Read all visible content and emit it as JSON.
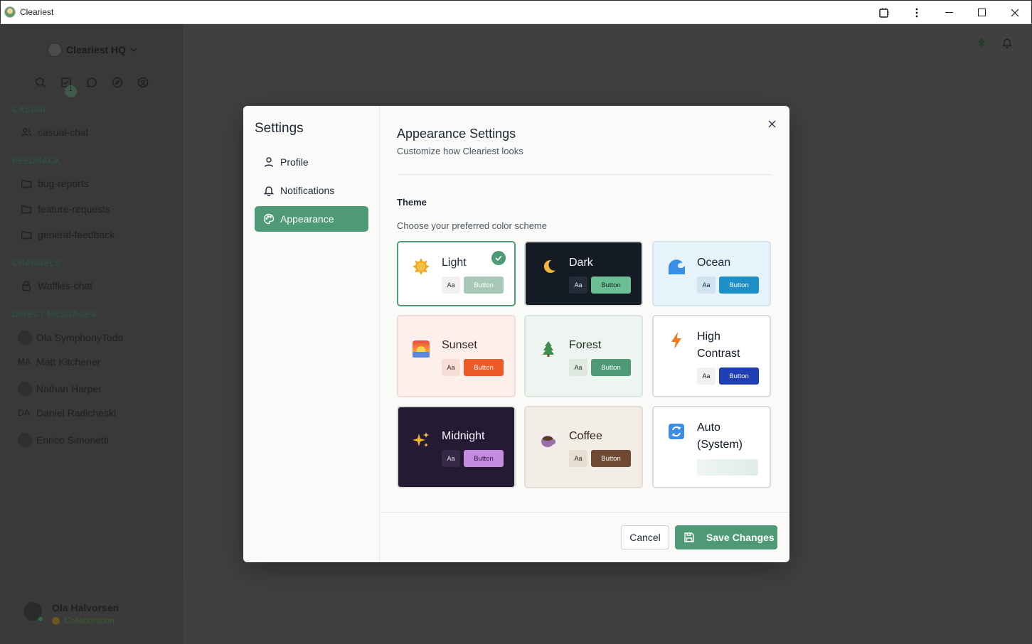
{
  "window": {
    "title": "Cleariest"
  },
  "workspace": {
    "name": "Cleariest HQ"
  },
  "sidebar": {
    "sections": [
      {
        "label": "CASUAL",
        "items": [
          "casual-chat"
        ]
      },
      {
        "label": "FEEDBACK",
        "items": [
          "bug-reports",
          "feature-requests",
          "general-feedback"
        ]
      },
      {
        "label": "CHANNELS",
        "items": [
          "Waffles-chat"
        ]
      },
      {
        "label": "DIRECT MESSAGES",
        "items": [
          "Ola SymphonyTodo",
          "Matt Kitchener",
          "Nathan Harper",
          "Daniel Radicheski",
          "Enrico Simonetti"
        ]
      }
    ],
    "dm_initials": {
      "matt": "MA",
      "daniel": "DA"
    },
    "tasks_badge": "1"
  },
  "user": {
    "name": "Ola Halvorsen",
    "role": "Collaboration"
  },
  "settings": {
    "title": "Settings",
    "nav": [
      {
        "label": "Profile",
        "icon": "user-icon"
      },
      {
        "label": "Notifications",
        "icon": "bell-icon"
      },
      {
        "label": "Appearance",
        "icon": "palette-icon",
        "active": true
      }
    ],
    "heading": "Appearance Settings",
    "subheading": "Customize how Cleariest looks",
    "theme_label": "Theme",
    "theme_sub": "Choose your preferred color scheme",
    "themes": [
      {
        "name": "Light",
        "icon": "sun-icon",
        "aa": "Aa",
        "button": "Button",
        "selected": true,
        "bg": "#ffffff",
        "accent": "#a8c9b8"
      },
      {
        "name": "Dark",
        "icon": "moon-icon",
        "aa": "Aa",
        "button": "Button",
        "bg": "#141b24",
        "accent": "#6bbf95"
      },
      {
        "name": "Ocean",
        "icon": "wave-icon",
        "aa": "Aa",
        "button": "Button",
        "bg": "#e6f3fa",
        "accent": "#1d8fc9"
      },
      {
        "name": "Sunset",
        "icon": "sunset-icon",
        "aa": "Aa",
        "button": "Button",
        "bg": "#fdf0ec",
        "accent": "#ec5b27"
      },
      {
        "name": "Forest",
        "icon": "tree-icon",
        "aa": "Aa",
        "button": "Button",
        "bg": "#eef5f0",
        "accent": "#4e9a77"
      },
      {
        "name": "High Contrast",
        "icon": "lightning-icon",
        "aa": "Aa",
        "button": "Button",
        "bg": "#ffffff",
        "accent": "#1d3eb5"
      },
      {
        "name": "Midnight",
        "icon": "sparkles-icon",
        "aa": "Aa",
        "button": "Button",
        "bg": "#241a33",
        "accent": "#c58be0"
      },
      {
        "name": "Coffee",
        "icon": "coffee-icon",
        "aa": "Aa",
        "button": "Button",
        "bg": "#f3ede7",
        "accent": "#6e4a32"
      },
      {
        "name": "Auto (System)",
        "icon": "refresh-icon",
        "bg": "#ffffff",
        "accent": "#dfeee6"
      }
    ],
    "cancel": "Cancel",
    "save": "Save Changes"
  }
}
